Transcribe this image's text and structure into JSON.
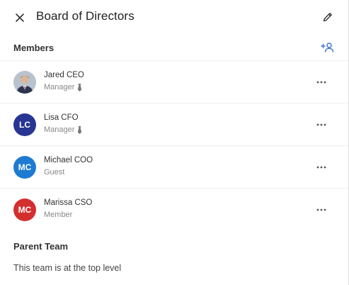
{
  "header": {
    "title": "Board of Directors"
  },
  "members_section": {
    "label": "Members",
    "items": [
      {
        "name": "Jared CEO",
        "role": "Manager",
        "initials": "",
        "avatar_type": "photo",
        "avatar_color": "#9aa7b8",
        "role_icon": "tie-icon"
      },
      {
        "name": "Lisa CFO",
        "role": "Manager",
        "initials": "LC",
        "avatar_type": "initials",
        "avatar_color": "#283593",
        "role_icon": "tie-icon"
      },
      {
        "name": "Michael COO",
        "role": "Guest",
        "initials": "MC",
        "avatar_type": "initials",
        "avatar_color": "#1e7bd1",
        "role_icon": ""
      },
      {
        "name": "Marissa CSO",
        "role": "Member",
        "initials": "MC",
        "avatar_type": "initials",
        "avatar_color": "#d32f2f",
        "role_icon": ""
      }
    ]
  },
  "parent_section": {
    "label": "Parent Team",
    "text": "This team is at the top level"
  },
  "colors": {
    "accent": "#3b6fd8"
  }
}
